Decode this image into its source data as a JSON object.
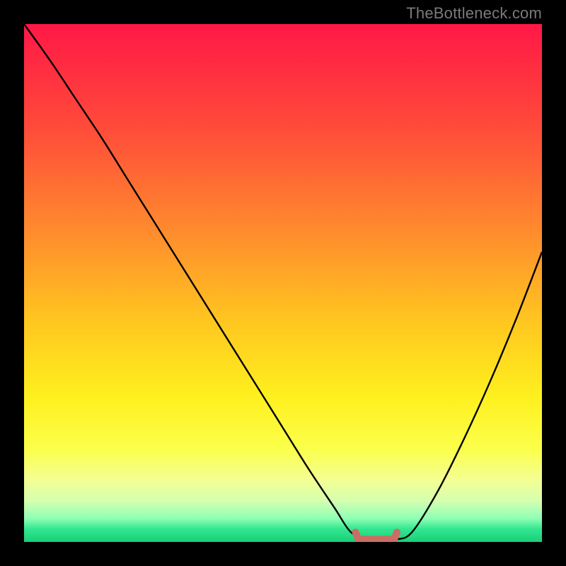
{
  "watermark": "TheBottleneck.com",
  "chart_data": {
    "type": "line",
    "title": "",
    "xlabel": "",
    "ylabel": "",
    "xlim": [
      0,
      100
    ],
    "ylim": [
      0,
      100
    ],
    "x": [
      0,
      5,
      10,
      15,
      20,
      25,
      30,
      35,
      40,
      45,
      50,
      55,
      60,
      63,
      66,
      69,
      72,
      75,
      80,
      85,
      90,
      95,
      100
    ],
    "values": [
      100,
      93,
      85.5,
      78,
      70,
      62,
      54,
      46,
      38,
      30,
      22,
      14,
      6.5,
      2,
      0.5,
      0.5,
      0.5,
      2,
      10,
      20,
      31,
      43,
      56
    ],
    "plateau": {
      "x_start": 64,
      "x_end": 72,
      "y": 0.5
    },
    "background_gradient_stops": [
      {
        "offset": 0.0,
        "color": "#ff1846"
      },
      {
        "offset": 0.2,
        "color": "#ff4b3a"
      },
      {
        "offset": 0.4,
        "color": "#ff8b2d"
      },
      {
        "offset": 0.58,
        "color": "#ffc81f"
      },
      {
        "offset": 0.72,
        "color": "#fef01f"
      },
      {
        "offset": 0.82,
        "color": "#fbff4a"
      },
      {
        "offset": 0.88,
        "color": "#f4ff93"
      },
      {
        "offset": 0.92,
        "color": "#d6ffb0"
      },
      {
        "offset": 0.955,
        "color": "#8dffb5"
      },
      {
        "offset": 0.975,
        "color": "#32e78f"
      },
      {
        "offset": 1.0,
        "color": "#18cf78"
      }
    ],
    "curve_stroke": "#000000",
    "plateau_marker_color": "#cb6d63"
  }
}
